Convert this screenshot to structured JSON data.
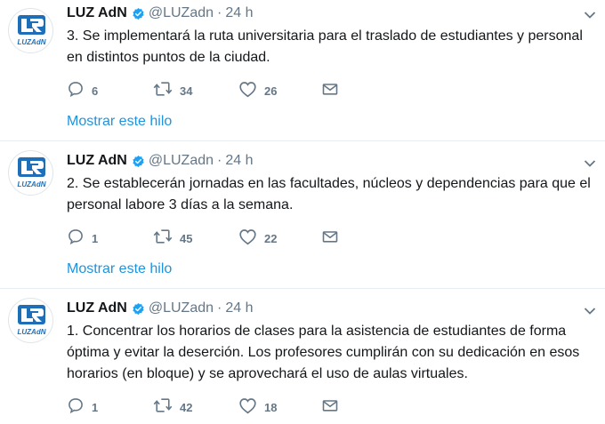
{
  "tweets": [
    {
      "name": "LUZ AdN",
      "handle": "@LUZadn",
      "separator": "·",
      "time": "24 h",
      "text_lines": [
        "3. Se implementará la ruta universitaria para el traslado de estudiantes y personal",
        "en distintos puntos de la ciudad."
      ],
      "replies": "6",
      "retweets": "34",
      "likes": "26",
      "thread_link": "Mostrar este hilo"
    },
    {
      "name": "LUZ AdN",
      "handle": "@LUZadn",
      "separator": "·",
      "time": "24 h",
      "text_lines": [
        "2. Se establecerán jornadas en las facultades, núcleos y dependencias para que el",
        "personal labore 3 días a la semana."
      ],
      "replies": "1",
      "retweets": "45",
      "likes": "22",
      "thread_link": "Mostrar este hilo"
    },
    {
      "name": "LUZ AdN",
      "handle": "@LUZadn",
      "separator": "·",
      "time": "24 h",
      "text_lines": [
        "1. Concentrar los horarios de clases para la asistencia de estudiantes de forma",
        "óptima y evitar la deserción. Los profesores cumplirán con su dedicación en esos",
        "horarios (en bloque) y se aprovechará el uso de aulas virtuales."
      ],
      "replies": "1",
      "retweets": "42",
      "likes": "18"
    }
  ],
  "avatar_logo_text": "LUZAdN",
  "colors": {
    "brand_blue": "#1c94e0",
    "logo_blue": "#1f6fb8",
    "text": "#14171a",
    "muted": "#657786",
    "divider": "#e6ecf0"
  },
  "icons": [
    "reply-icon",
    "retweet-icon",
    "like-icon",
    "direct-message-icon",
    "verified-icon",
    "chevron-down-icon"
  ]
}
